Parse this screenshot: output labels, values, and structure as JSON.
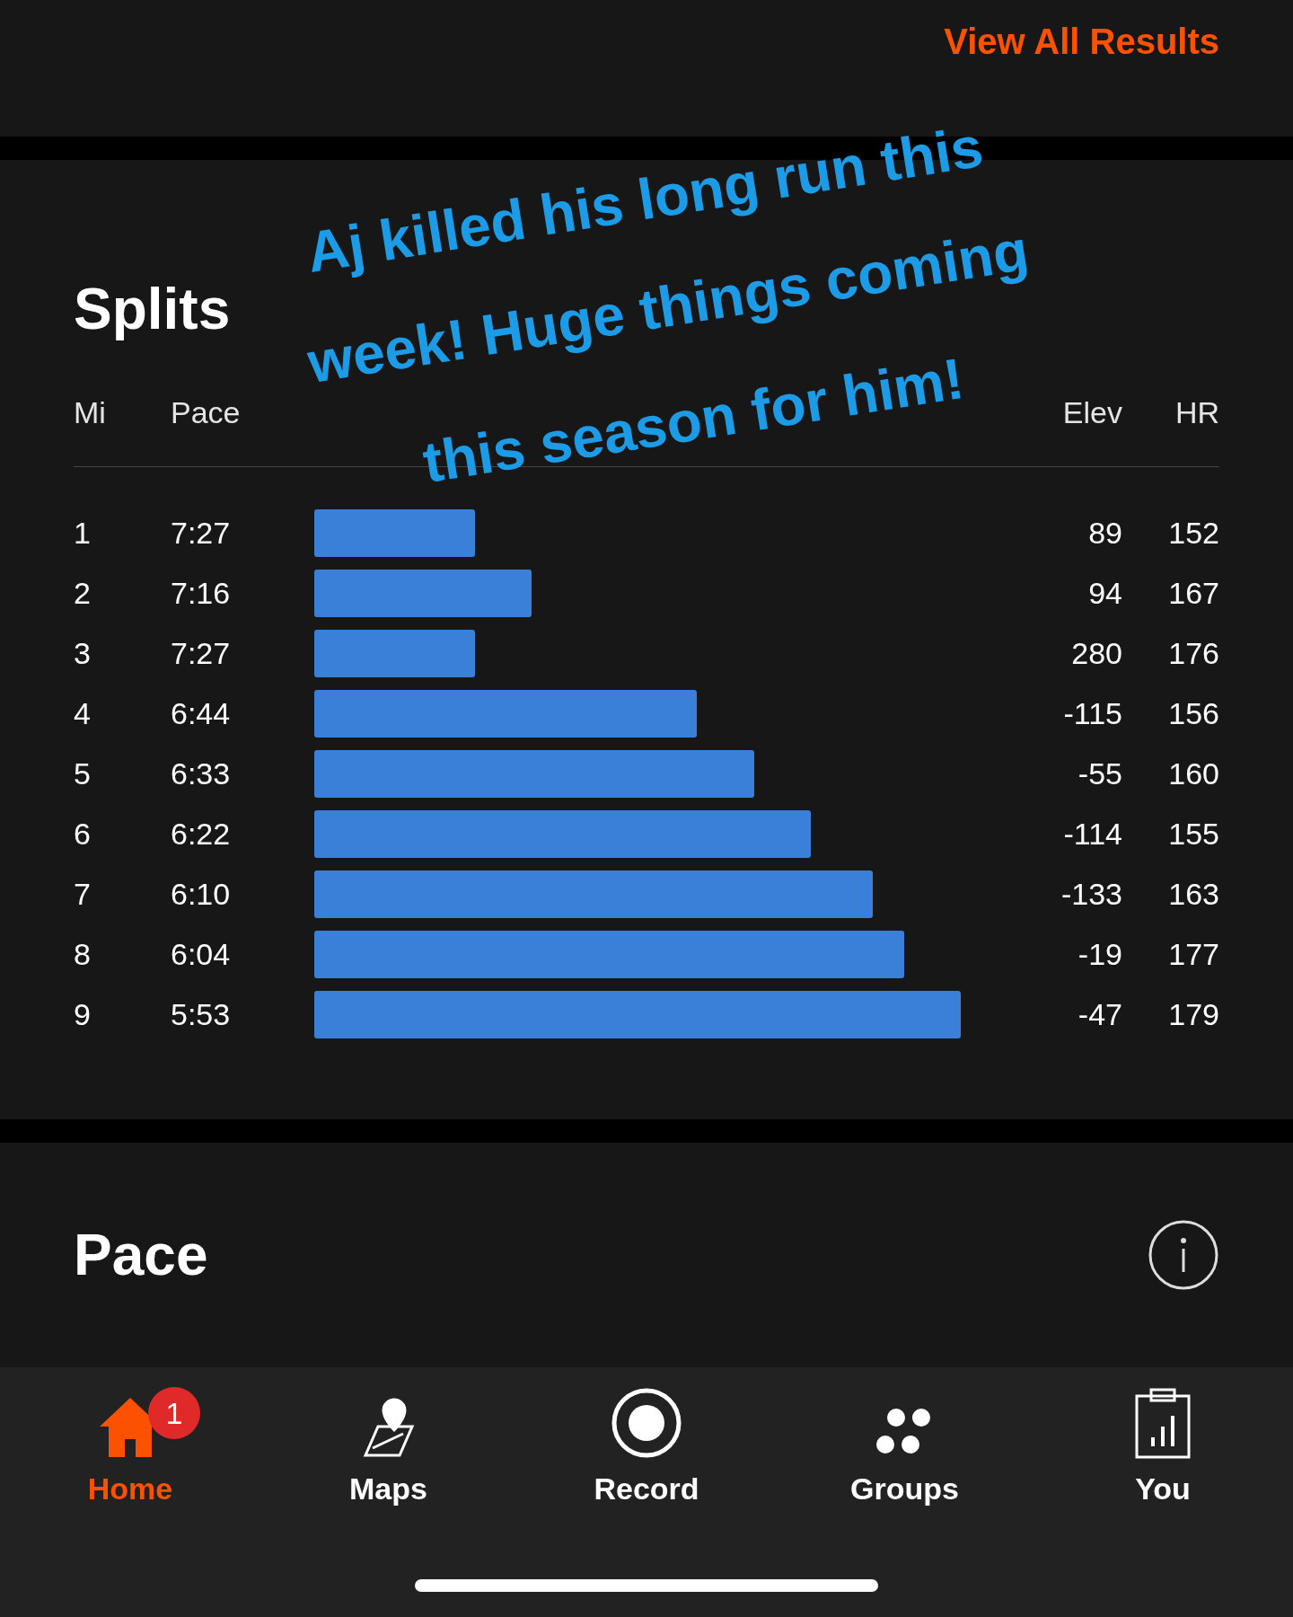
{
  "header_link": "View All Results",
  "splits": {
    "title": "Splits",
    "columns": [
      "Mi",
      "Pace",
      "Elev",
      "HR"
    ],
    "rows": [
      {
        "mi": "1",
        "pace": "7:27",
        "elev": "89",
        "hr": "152"
      },
      {
        "mi": "2",
        "pace": "7:16",
        "elev": "94",
        "hr": "167"
      },
      {
        "mi": "3",
        "pace": "7:27",
        "elev": "280",
        "hr": "176"
      },
      {
        "mi": "4",
        "pace": "6:44",
        "elev": "-115",
        "hr": "156"
      },
      {
        "mi": "5",
        "pace": "6:33",
        "elev": "-55",
        "hr": "160"
      },
      {
        "mi": "6",
        "pace": "6:22",
        "elev": "-114",
        "hr": "155"
      },
      {
        "mi": "7",
        "pace": "6:10",
        "elev": "-133",
        "hr": "163"
      },
      {
        "mi": "8",
        "pace": "6:04",
        "elev": "-19",
        "hr": "177"
      },
      {
        "mi": "9",
        "pace": "5:53",
        "elev": "-47",
        "hr": "179"
      }
    ]
  },
  "pace": {
    "title": "Pace"
  },
  "annotation": [
    "Aj killed his long run this",
    "week! Huge things coming",
    "this season for him!"
  ],
  "tab_bar": [
    {
      "kind": "home",
      "label": "Home",
      "selected": true,
      "badge": "1"
    },
    {
      "kind": "maps",
      "label": "Maps",
      "selected": false
    },
    {
      "kind": "record",
      "label": "Record",
      "selected": false
    },
    {
      "kind": "groups",
      "label": "Groups",
      "selected": false
    },
    {
      "kind": "you",
      "label": "You",
      "selected": false
    }
  ]
}
